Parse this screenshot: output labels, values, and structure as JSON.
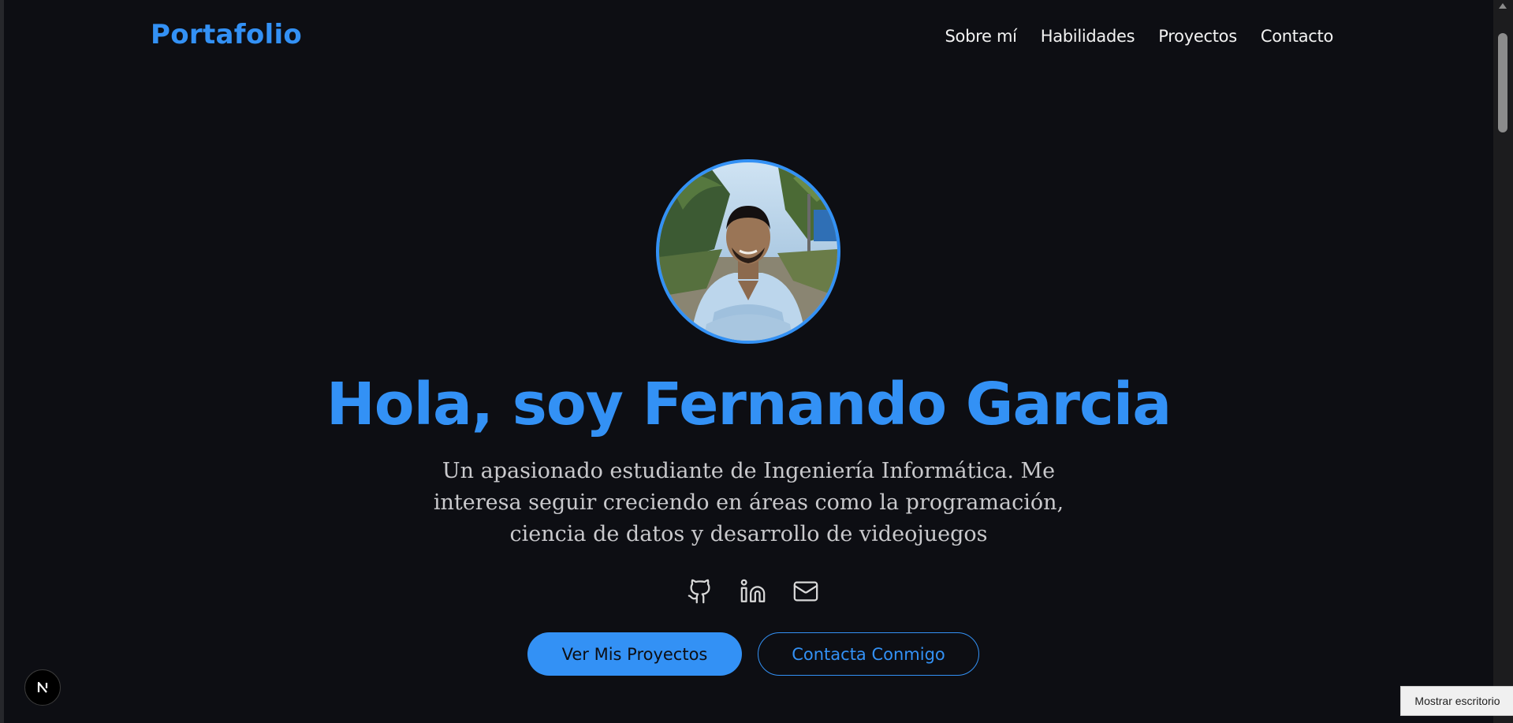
{
  "header": {
    "logo": "Portafolio",
    "nav": [
      {
        "label": "Sobre mí"
      },
      {
        "label": "Habilidades"
      },
      {
        "label": "Proyectos"
      },
      {
        "label": "Contacto"
      }
    ]
  },
  "hero": {
    "avatar_icon": "profile-photo",
    "title": "Hola, soy Fernando Garcia",
    "description": "Un apasionado estudiante de Ingeniería Informática. Me interesa seguir creciendo en áreas como la programación, ciencia de datos y desarrollo de videojuegos",
    "social": [
      {
        "icon": "github-icon"
      },
      {
        "icon": "linkedin-icon"
      },
      {
        "icon": "mail-icon"
      }
    ],
    "primary_button": "Ver Mis Proyectos",
    "secondary_button": "Contacta Conmigo"
  },
  "overlay": {
    "next_badge_letter": "N",
    "tooltip": "Mostrar escritorio"
  },
  "colors": {
    "accent": "#3391f5",
    "background": "#0d0e13",
    "text": "#f2f2f2",
    "muted_text": "#c9c9cc"
  }
}
